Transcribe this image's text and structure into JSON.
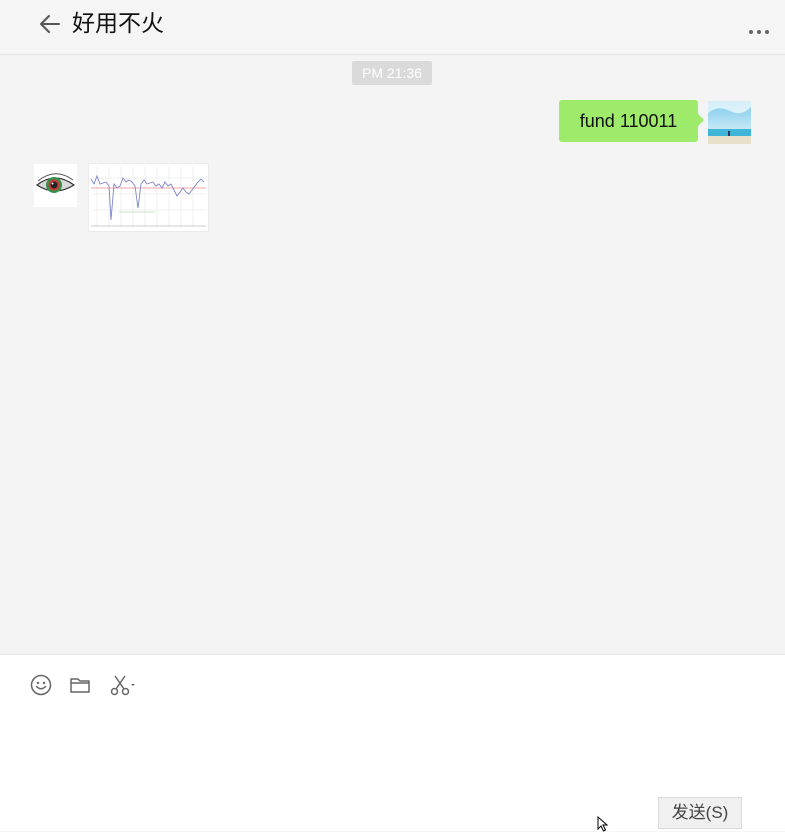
{
  "header": {
    "title": "好用不火"
  },
  "chat": {
    "timestamp": "PM 21:36",
    "messages": [
      {
        "from": "self",
        "type": "text",
        "text": "fund 110011"
      },
      {
        "from": "other",
        "type": "image"
      }
    ]
  },
  "composer": {
    "send_label": "发送(S)"
  },
  "icons": {
    "back": "arrow-left-icon",
    "more": "more-icon",
    "emoji": "emoji-icon",
    "file": "folder-icon",
    "screenshot": "scissors-icon"
  },
  "colors": {
    "bubble_out": "#9eea6a",
    "chat_bg": "#f4f4f4",
    "timestamp_bg": "#dadada"
  }
}
